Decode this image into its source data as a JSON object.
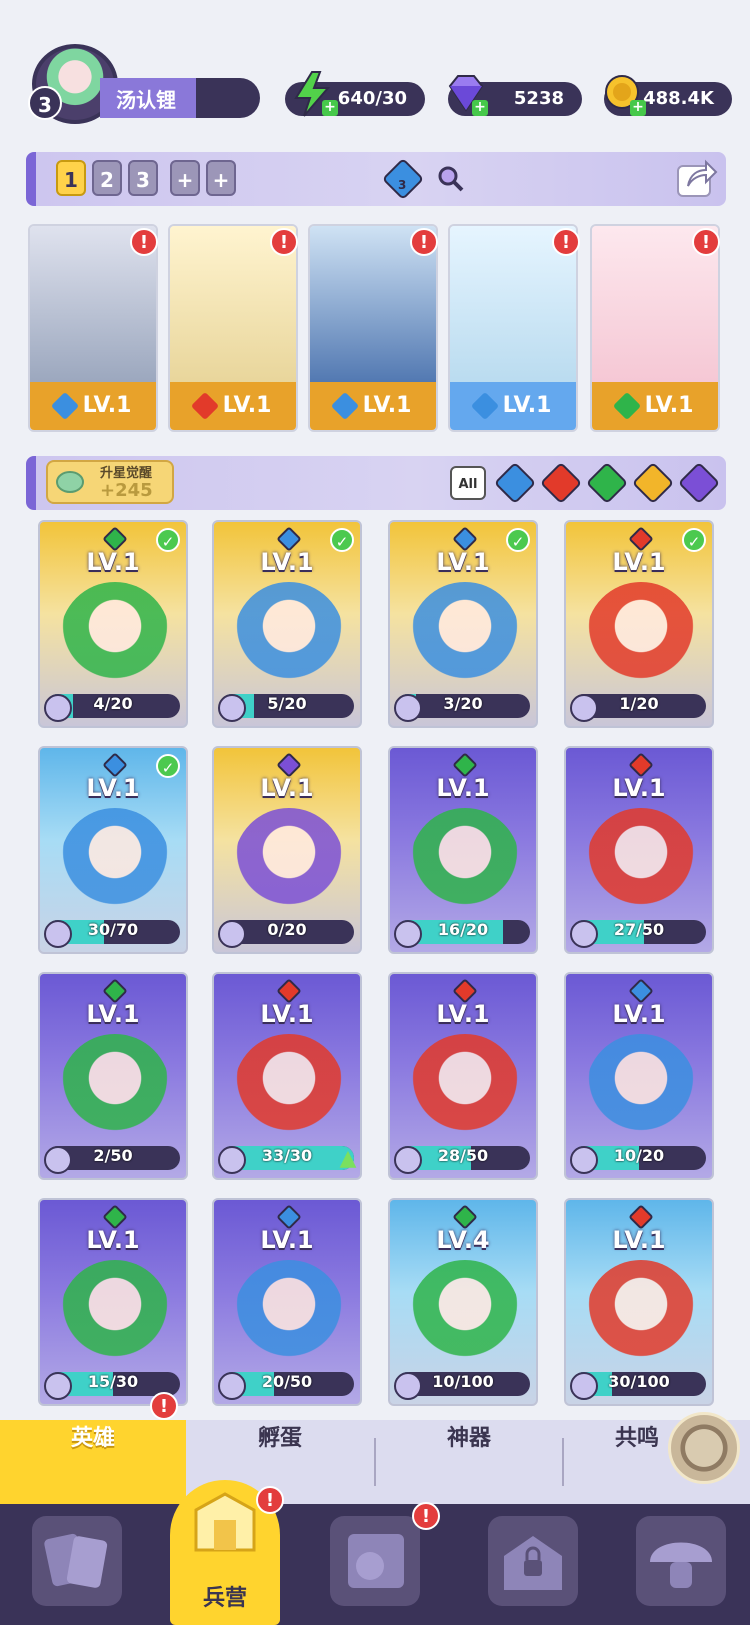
{
  "player": {
    "level": "3",
    "name": "汤认锂"
  },
  "resources": {
    "energy": "640/30",
    "gems": "5238",
    "gold": "488.4K"
  },
  "team": {
    "tabs": [
      "1",
      "2",
      "3",
      "+",
      "+"
    ],
    "active_tab": 0,
    "search_count": "3",
    "cards": [
      {
        "level": "LV.1",
        "element": "water",
        "band": "gold"
      },
      {
        "level": "LV.1",
        "element": "fire",
        "band": "gold"
      },
      {
        "level": "LV.1",
        "element": "water",
        "band": "gold"
      },
      {
        "level": "LV.1",
        "element": "water",
        "band": "blue"
      },
      {
        "level": "LV.1",
        "element": "wood",
        "band": "gold"
      }
    ]
  },
  "awaken": {
    "title": "升星觉醒",
    "value": "+245"
  },
  "filters": [
    "All",
    "water",
    "fire",
    "wood",
    "light",
    "dark"
  ],
  "heroes": [
    {
      "level": "LV.1",
      "shards": "4/20",
      "progress": 0.2,
      "element": "wood",
      "rarity": "gold",
      "owned": true
    },
    {
      "level": "LV.1",
      "shards": "5/20",
      "progress": 0.25,
      "element": "water",
      "rarity": "gold",
      "owned": true
    },
    {
      "level": "LV.1",
      "shards": "3/20",
      "progress": 0.15,
      "element": "water",
      "rarity": "gold",
      "owned": true
    },
    {
      "level": "LV.1",
      "shards": "1/20",
      "progress": 0.05,
      "element": "fire",
      "rarity": "gold",
      "owned": true
    },
    {
      "level": "LV.1",
      "shards": "30/70",
      "progress": 0.43,
      "element": "water",
      "rarity": "blue",
      "owned": true
    },
    {
      "level": "LV.1",
      "shards": "0/20",
      "progress": 0.0,
      "element": "dark",
      "rarity": "gold",
      "owned": false
    },
    {
      "level": "LV.1",
      "shards": "16/20",
      "progress": 0.8,
      "element": "wood",
      "rarity": "purple",
      "owned": false
    },
    {
      "level": "LV.1",
      "shards": "27/50",
      "progress": 0.54,
      "element": "fire",
      "rarity": "purple",
      "owned": false
    },
    {
      "level": "LV.1",
      "shards": "2/50",
      "progress": 0.04,
      "element": "wood",
      "rarity": "purple",
      "owned": false
    },
    {
      "level": "LV.1",
      "shards": "33/30",
      "progress": 1.0,
      "element": "fire",
      "rarity": "purple",
      "owned": false,
      "upgrade": true
    },
    {
      "level": "LV.1",
      "shards": "28/50",
      "progress": 0.56,
      "element": "fire",
      "rarity": "purple",
      "owned": false
    },
    {
      "level": "LV.1",
      "shards": "10/20",
      "progress": 0.5,
      "element": "water",
      "rarity": "purple",
      "owned": false
    },
    {
      "level": "LV.1",
      "shards": "15/30",
      "progress": 0.5,
      "element": "wood",
      "rarity": "purple",
      "owned": false
    },
    {
      "level": "LV.1",
      "shards": "20/50",
      "progress": 0.4,
      "element": "water",
      "rarity": "purple",
      "owned": false
    },
    {
      "level": "LV.4",
      "shards": "10/100",
      "progress": 0.1,
      "element": "wood",
      "rarity": "blue",
      "owned": false
    },
    {
      "level": "LV.1",
      "shards": "30/100",
      "progress": 0.3,
      "element": "fire",
      "rarity": "blue",
      "owned": false
    }
  ],
  "subtabs": [
    "英雄",
    "孵蛋",
    "神器",
    "共鸣"
  ],
  "nav": {
    "active_label": "兵营"
  },
  "colors": {
    "water": "#3b8fe0",
    "fire": "#e23a2a",
    "wood": "#2fb44a",
    "light": "#f2b52a",
    "dark": "#7b4fd6",
    "accent": "#ffd42e",
    "panel": "#3a3358"
  }
}
